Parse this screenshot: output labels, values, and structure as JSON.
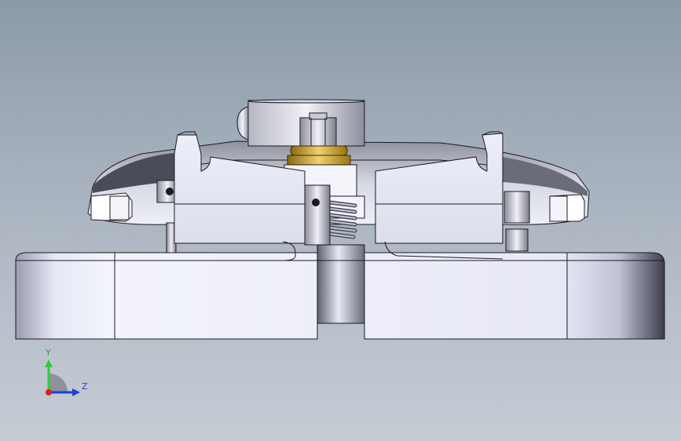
{
  "viewport": {
    "view_orientation": "front"
  },
  "triad": {
    "y_label": "Y",
    "z_label": "Z",
    "colors": {
      "y_axis": "#2ecc40",
      "z_axis": "#1f3fd8",
      "origin": "#d62020"
    }
  },
  "model": {
    "colors": {
      "base_body": "#e4e6f4",
      "base_shade": "#9a9cb0",
      "dome_body": "#d7d9e6",
      "dome_shade": "#4a4c58",
      "brass_washer": "#d4a21a",
      "edge": "#1a1a22"
    }
  }
}
